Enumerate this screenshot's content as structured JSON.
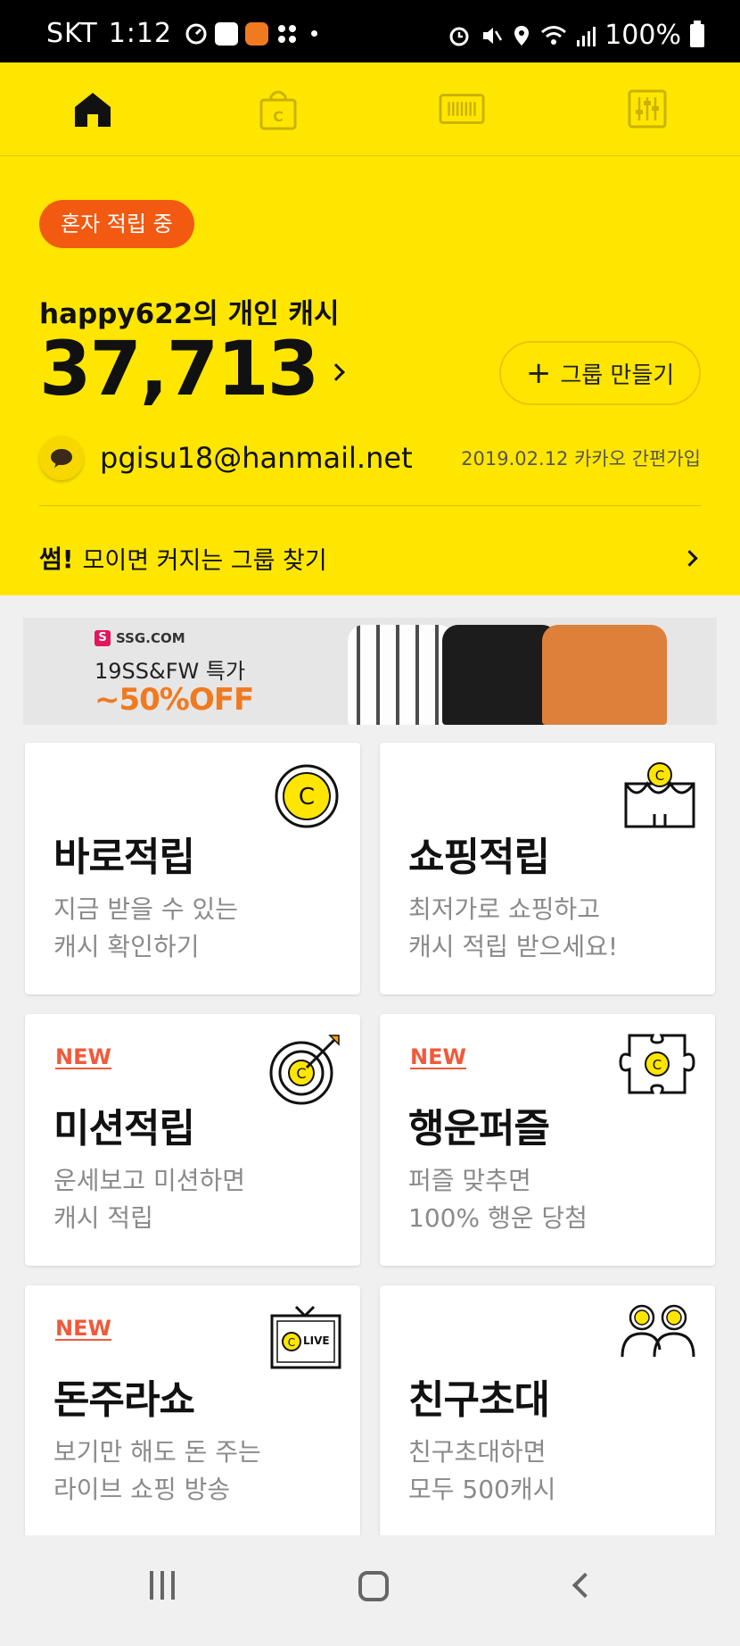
{
  "status_bar": {
    "carrier": "SKT",
    "time": "1:12",
    "battery": "100%"
  },
  "top_nav": {
    "tabs": [
      "home",
      "shopping",
      "barcode",
      "settings"
    ]
  },
  "header": {
    "badge": "혼자 적립 중",
    "cash_title": "happy622의 개인 캐시",
    "cash_amount": "37,713",
    "group_button": "그룹 만들기",
    "email": "pgisu18@hanmail.net",
    "join_info": "2019.02.12 카카오 간편가입",
    "ssum_bold": "썸!",
    "ssum_text": "모이면 커지는 그룹 찾기"
  },
  "banner": {
    "brand": "SSG.COM",
    "line1": "19SS&FW 특가",
    "line2": "~50%OFF"
  },
  "cards": [
    {
      "new": "",
      "title": "바로적립",
      "desc": "지금 받을 수 있는\n캐시 확인하기",
      "icon": "coin-icon"
    },
    {
      "new": "",
      "title": "쇼핑적립",
      "desc": "최저가로 쇼핑하고\n캐시 적립 받으세요!",
      "icon": "shop-icon"
    },
    {
      "new": "NEW",
      "title": "미션적립",
      "desc": "운세보고 미션하면\n캐시 적립",
      "icon": "target-icon"
    },
    {
      "new": "NEW",
      "title": "행운퍼즐",
      "desc": "퍼즐 맞추면\n100% 행운 당첨",
      "icon": "puzzle-icon"
    },
    {
      "new": "NEW",
      "title": "돈주라쇼",
      "desc": "보기만 해도 돈 주는\n라이브 쇼핑 방송",
      "icon": "tv-live-icon"
    },
    {
      "new": "",
      "title": "친구초대",
      "desc": "친구초대하면\n모두 500캐시",
      "icon": "friends-icon"
    }
  ],
  "tv_label": "LIVE",
  "colors": {
    "brand_yellow": "#ffe600",
    "badge_orange": "#f25a12",
    "new_red": "#f05a3a"
  }
}
